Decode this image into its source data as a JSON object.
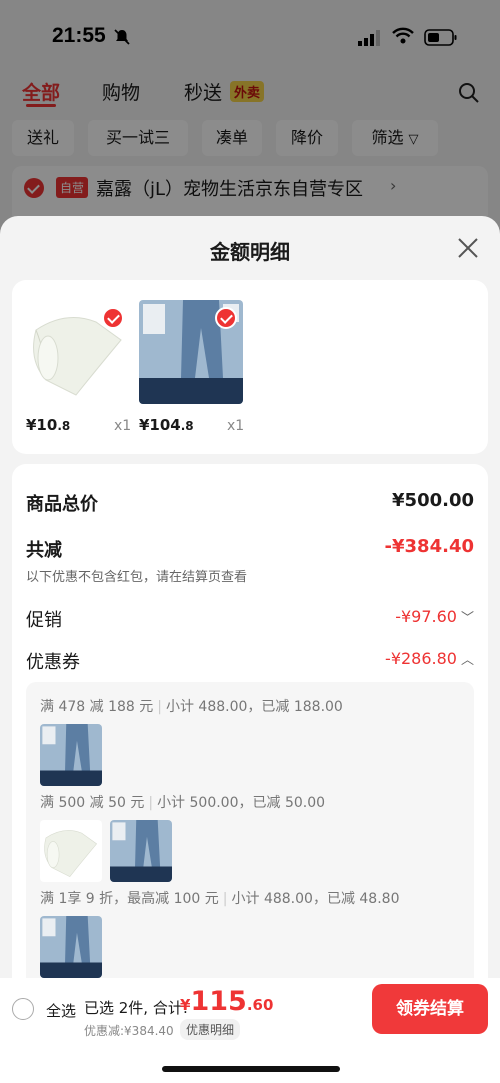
{
  "status_bar": {
    "time": "21:55"
  },
  "top_tabs": {
    "items": [
      "全部",
      "购物",
      "秒送"
    ],
    "badge": "外卖",
    "active": "全部"
  },
  "filters": [
    "送礼",
    "买一试三",
    "凑单",
    "降价",
    "筛选"
  ],
  "shop": {
    "tag": "自营",
    "name": "嘉露（jL）宠物生活京东自营专区"
  },
  "sheet": {
    "title": "金额明细",
    "products": [
      {
        "price_int": "¥10",
        "price_dec": ".8",
        "qty": "x1"
      },
      {
        "price_int": "¥104",
        "price_dec": ".8",
        "qty": "x1"
      }
    ],
    "summary": {
      "total_label": "商品总价",
      "total_value": "¥500.00",
      "reduce_label": "共减",
      "reduce_value": "-¥384.40",
      "reduce_note": "以下优惠不包含红包，请在结算页查看",
      "promo_label": "促销",
      "promo_value": "-¥97.60",
      "coupon_label": "优惠券",
      "coupon_value": "-¥286.80"
    },
    "coupon_rules": [
      {
        "condition": "满 478 减 188 元",
        "detail": "小计 488.00，已减 188.00"
      },
      {
        "condition": "满 500 减 50 元",
        "detail": "小计 500.00，已减 50.00"
      },
      {
        "condition": "满 1享 9 折，最高减 100 元",
        "detail": "小计 488.00，已减 48.80"
      }
    ]
  },
  "bottom_bar": {
    "select_all": "全选",
    "selected": "已选 2件, 合计:",
    "total_yen": "¥",
    "total_int": "115",
    "total_dec": ".60",
    "discount": "优惠减:¥384.40",
    "detail_link": "优惠明细",
    "checkout": "领券结算"
  },
  "colors": {
    "accent": "#e33333",
    "button": "#f0393a"
  }
}
